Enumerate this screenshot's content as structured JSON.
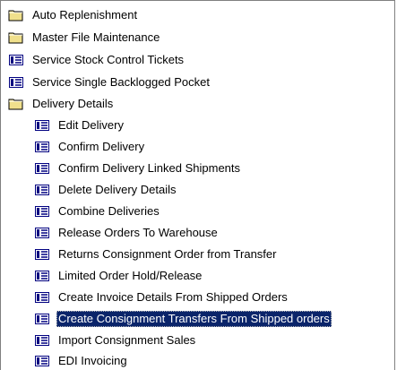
{
  "tree": {
    "items": [
      {
        "label": "Auto Replenishment",
        "icon": "folder-icon",
        "level": 0
      },
      {
        "label": "Master File Maintenance",
        "icon": "folder-icon",
        "level": 0
      },
      {
        "label": "Service Stock Control Tickets",
        "icon": "form-icon",
        "level": 0
      },
      {
        "label": "Service Single Backlogged Pocket",
        "icon": "form-icon",
        "level": 0
      },
      {
        "label": "Delivery Details",
        "icon": "folder-icon",
        "level": 0
      },
      {
        "label": "Edit Delivery",
        "icon": "form-icon",
        "level": 1
      },
      {
        "label": "Confirm Delivery",
        "icon": "form-icon",
        "level": 1
      },
      {
        "label": "Confirm Delivery Linked Shipments",
        "icon": "form-icon",
        "level": 1
      },
      {
        "label": "Delete Delivery Details",
        "icon": "form-icon",
        "level": 1
      },
      {
        "label": "Combine Deliveries",
        "icon": "form-icon",
        "level": 1
      },
      {
        "label": "Release Orders To Warehouse",
        "icon": "form-icon",
        "level": 1
      },
      {
        "label": "Returns Consignment Order from Transfer",
        "icon": "form-icon",
        "level": 1
      },
      {
        "label": "Limited Order Hold/Release",
        "icon": "form-icon",
        "level": 1
      },
      {
        "label": "Create Invoice Details From Shipped Orders",
        "icon": "form-icon",
        "level": 1
      },
      {
        "label": "Create Consignment Transfers From Shipped orders",
        "icon": "form-icon",
        "level": 1,
        "selected": true
      },
      {
        "label": "Import Consignment Sales",
        "icon": "form-icon",
        "level": 1
      },
      {
        "label": "EDI Invoicing",
        "icon": "form-icon",
        "level": 1
      }
    ]
  },
  "colors": {
    "selection": "#0a246a",
    "folder": "#f0e08c",
    "form": "#000080"
  }
}
